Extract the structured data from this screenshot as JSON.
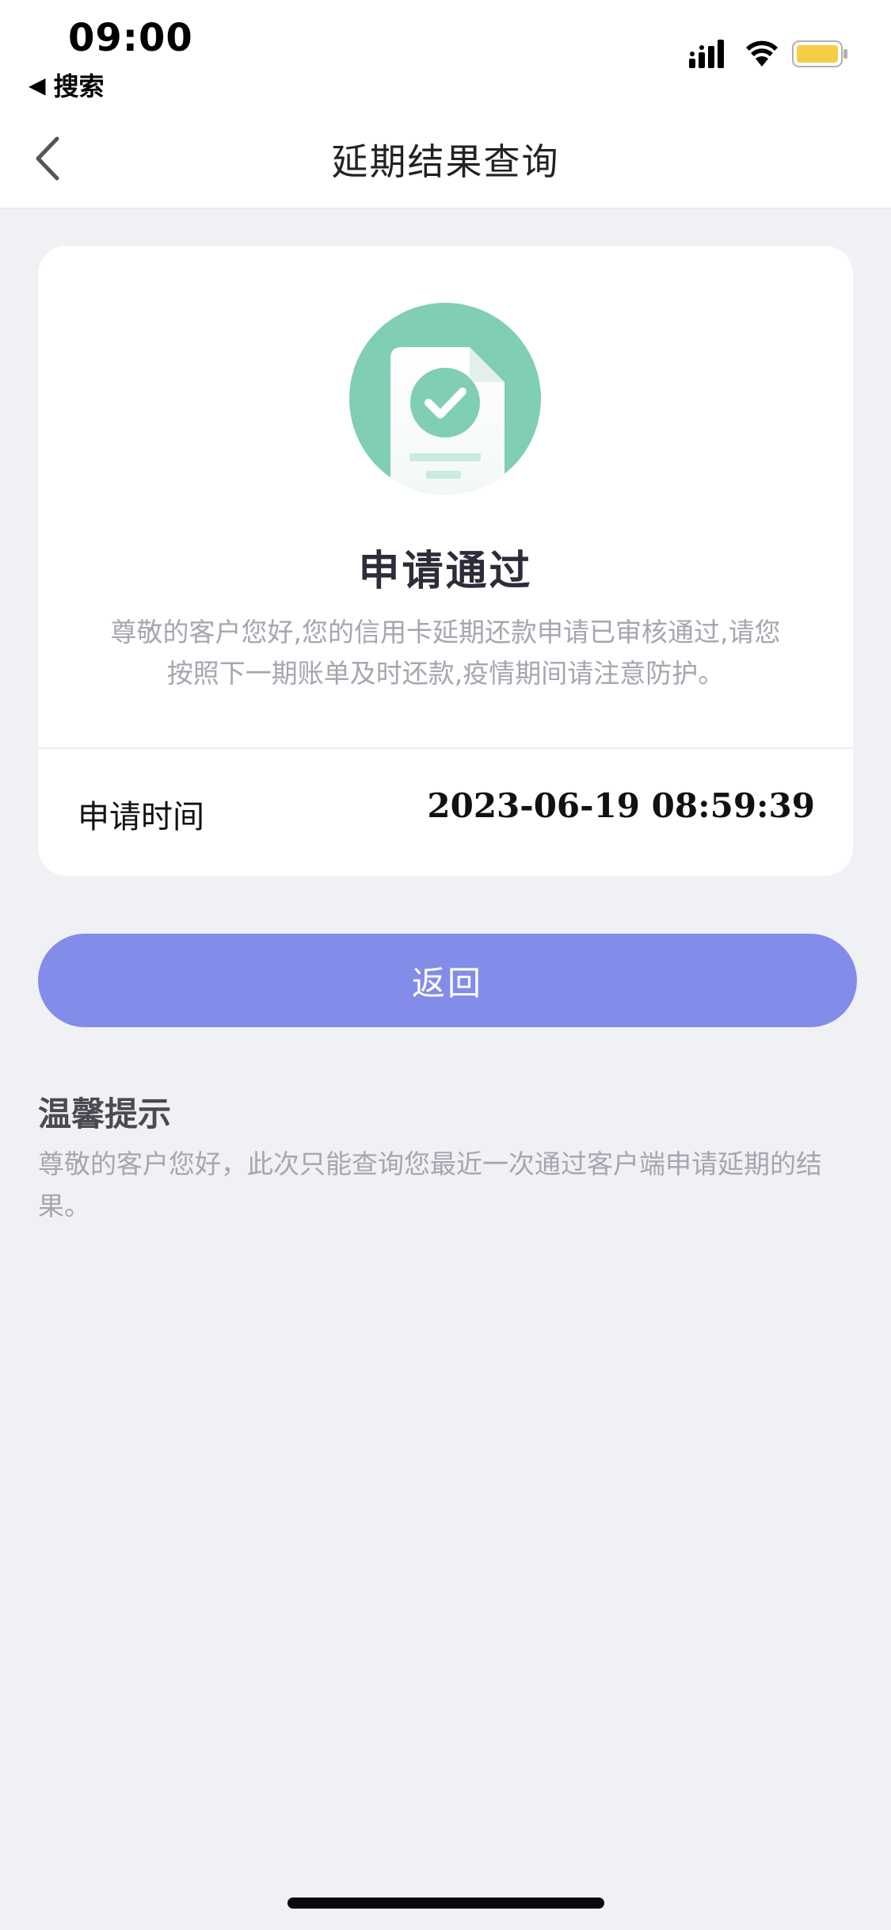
{
  "status_bar": {
    "time": "09:00",
    "back_app_label": "搜索",
    "back_triangle": "◀",
    "battery_color": "#f5cd47"
  },
  "nav": {
    "title": "延期结果查询"
  },
  "result": {
    "title": "申请通过",
    "description": "尊敬的客户您好,您的信用卡延期还款申请已审核通过,请您按照下一期账单及时还款,疫情期间请注意防护。",
    "icon": "document-check-icon",
    "icon_color": "#7fceb5",
    "apply_time_label": "申请时间",
    "apply_time_value": "2023-06-19 08:59:39"
  },
  "actions": {
    "return_label": "返回",
    "button_color": "#838ce9"
  },
  "tips": {
    "title": "温馨提示",
    "text": "尊敬的客户您好，此次只能查询您最近一次通过客户端申请延期的结果。"
  }
}
